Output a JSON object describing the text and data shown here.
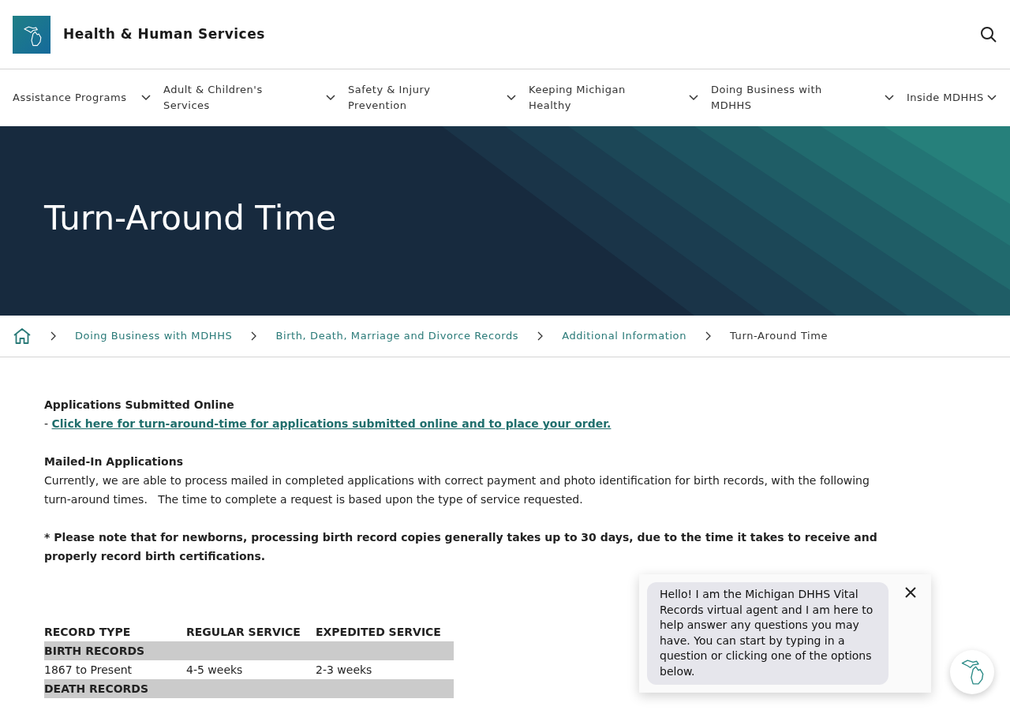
{
  "header": {
    "title": "Health & Human Services"
  },
  "nav": [
    {
      "label": "Assistance Programs"
    },
    {
      "label": "Adult & Children's Services"
    },
    {
      "label": "Safety & Injury Prevention"
    },
    {
      "label": "Keeping Michigan Healthy"
    },
    {
      "label": "Doing Business with MDHHS"
    },
    {
      "label": "Inside MDHHS"
    }
  ],
  "hero": {
    "title": "Turn-Around Time"
  },
  "breadcrumb": [
    {
      "label": "Doing Business with MDHHS",
      "current": false
    },
    {
      "label": "Birth, Death, Marriage and Divorce Records",
      "current": false
    },
    {
      "label": "Additional Information",
      "current": false
    },
    {
      "label": "Turn-Around Time",
      "current": true
    }
  ],
  "content": [
    {
      "kind": "heading",
      "text": "Applications Submitted Online"
    },
    {
      "kind": "link",
      "prefix": "-",
      "text": "Click here for turn-around-time for applications submitted online and to place your order."
    },
    {
      "kind": "heading",
      "text": "Mailed-In Applications"
    },
    {
      "kind": "paragraph",
      "text": "Currently, we are able to process mailed in completed applications with correct payment and photo identification for birth records, with the following turn-around times.   The time to complete a request is based upon the type of service requested."
    },
    {
      "kind": "note",
      "text": "* Please note that for newborns, processing birth record copies generally takes up to 30 days, due to the time it takes to receive and properly record birth certifications."
    }
  ],
  "table": {
    "columns": [
      "RECORD TYPE",
      "REGULAR SERVICE",
      "EXPEDITED SERVICE"
    ],
    "rows": [
      {
        "kind": "group",
        "cells": [
          "BIRTH RECORDS"
        ]
      },
      {
        "kind": "row",
        "cells": [
          "1867 to Present",
          "4-5 weeks",
          "2-3 weeks"
        ]
      },
      {
        "kind": "group",
        "cells": [
          "DEATH RECORDS"
        ]
      }
    ]
  },
  "chat": {
    "message": "Hello! I am the Michigan DHHS Vital Records virtual agent and I am here to help answer any questions you may have. You can start by typing in a question or clicking one of the options below."
  }
}
